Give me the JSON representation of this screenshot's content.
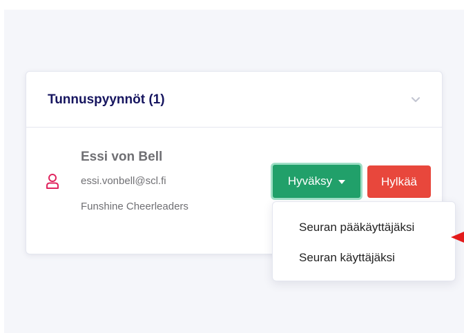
{
  "card": {
    "title": "Tunnuspyynnöt (1)",
    "collapse_icon": "chevron-down-icon"
  },
  "request": {
    "name": "Essi von Bell",
    "email": "essi.vonbell@scl.fi",
    "club": "Funshine Cheerleaders",
    "icon": "user-icon"
  },
  "actions": {
    "approve_label": "Hyväksy",
    "reject_label": "Hylkää"
  },
  "dropdown": {
    "items": [
      {
        "label": "Seuran pääkäyttäjäksi"
      },
      {
        "label": "Seuran käyttäjäksi"
      }
    ]
  },
  "colors": {
    "title": "#16155f",
    "approve": "#21a06a",
    "reject": "#e8473c",
    "user_icon": "#e0245e",
    "annotation_arrow": "#e31b1b"
  }
}
